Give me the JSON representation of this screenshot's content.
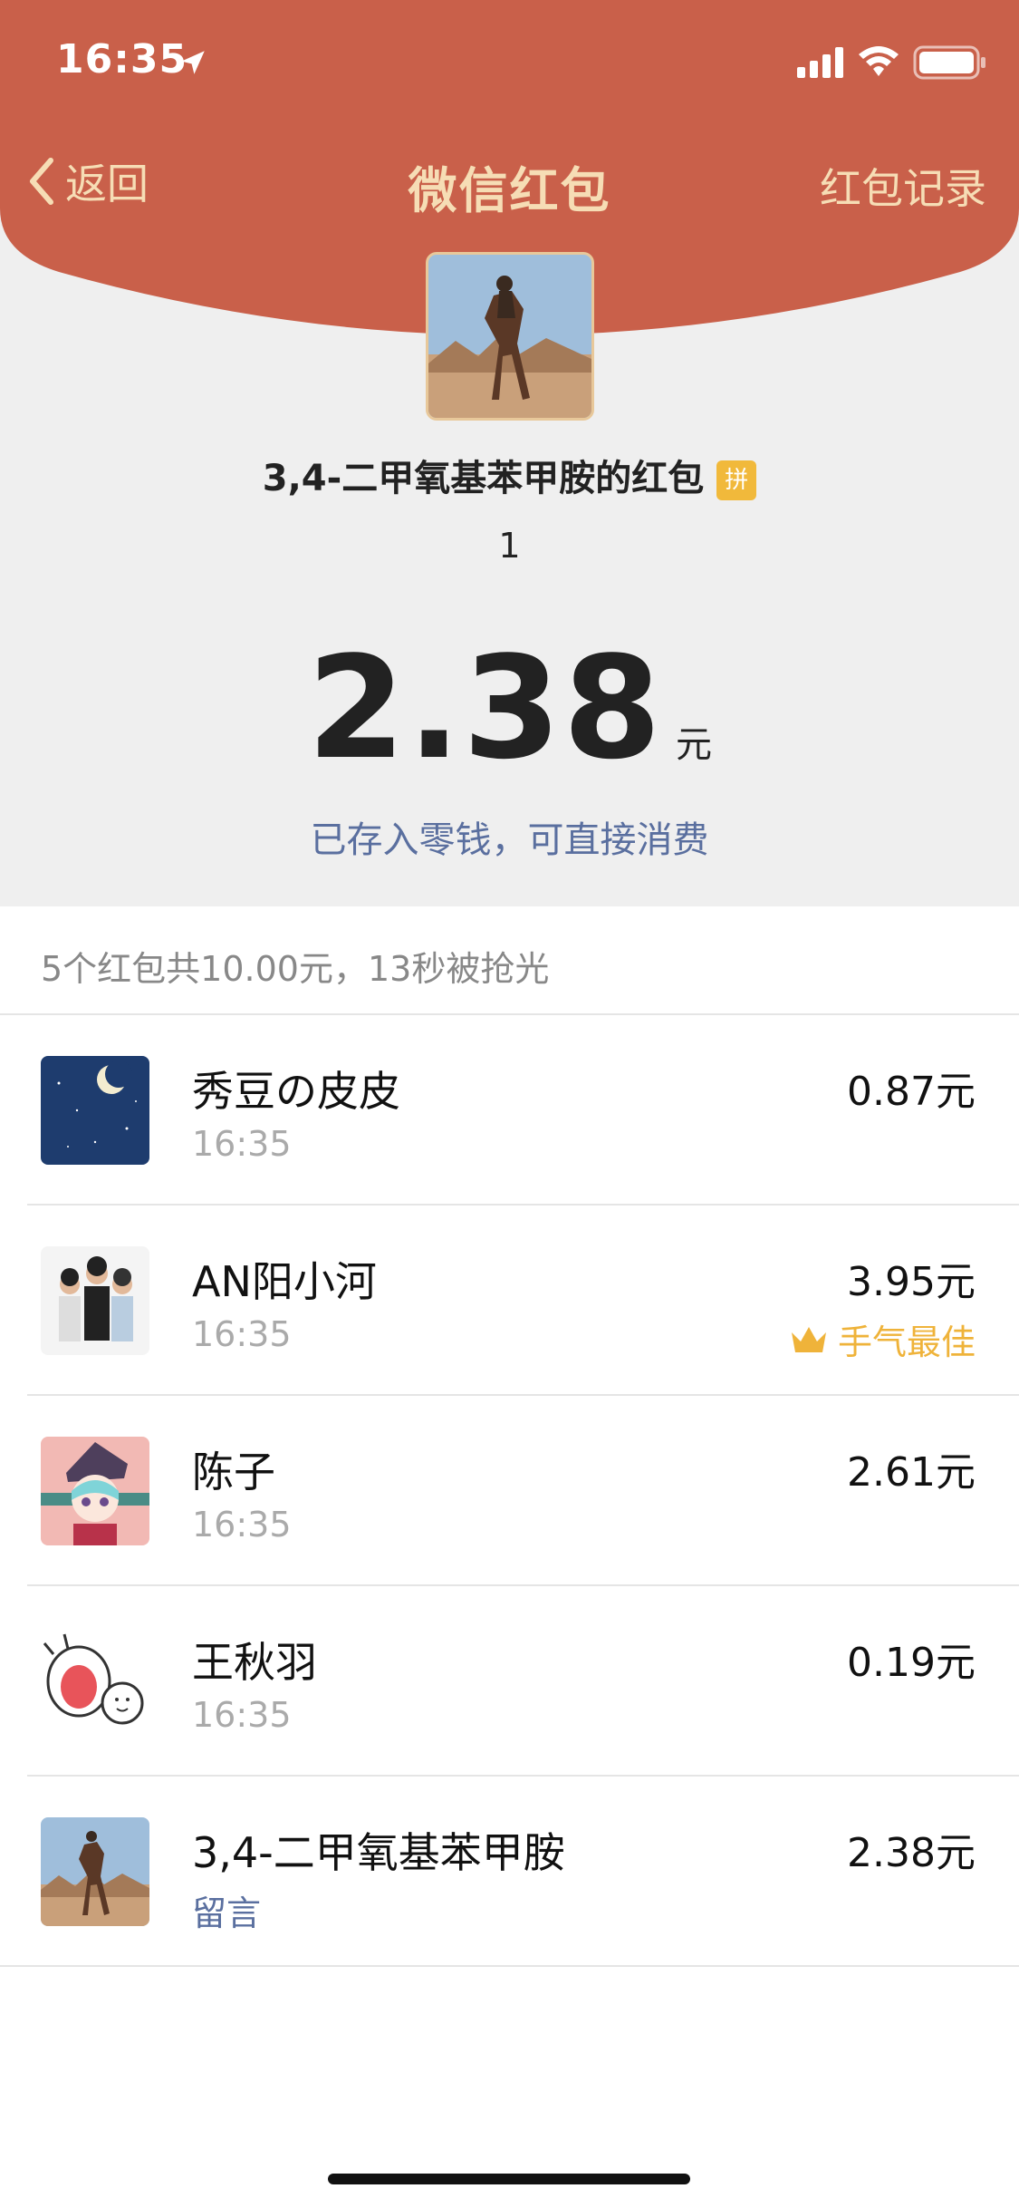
{
  "status": {
    "time": "16:35"
  },
  "nav": {
    "back_label": "返回",
    "title": "微信红包",
    "right_label": "红包记录"
  },
  "sender": {
    "title": "3,4-二甲氧基苯甲胺的红包",
    "badge": "拼",
    "greeting": "1"
  },
  "amount": {
    "value": "2.38",
    "unit": "元"
  },
  "saved_note": "已存入零钱，可直接消费",
  "summary": "5个红包共10.00元，13秒被抢光",
  "list": [
    {
      "name": "秀豆の皮皮",
      "sub": "16:35",
      "amount": "0.87元"
    },
    {
      "name": "AN阳小河",
      "sub": "16:35",
      "amount": "3.95元",
      "best_label": "手气最佳"
    },
    {
      "name": "陈子",
      "sub": "16:35",
      "amount": "2.61元"
    },
    {
      "name": "王秋羽",
      "sub": "16:35",
      "amount": "0.19元"
    },
    {
      "name": "3,4-二甲氧基苯甲胺",
      "sub": "留言",
      "amount": "2.38元"
    }
  ],
  "colors": {
    "header_red": "#c9604a",
    "gold_text": "#f6ddb5",
    "link_blue": "#5a6f9f",
    "best_gold": "#efb33a"
  },
  "icons": [
    "location-arrow-icon",
    "signal-icon",
    "wifi-icon",
    "battery-icon",
    "back-chevron-icon",
    "crown-icon"
  ]
}
